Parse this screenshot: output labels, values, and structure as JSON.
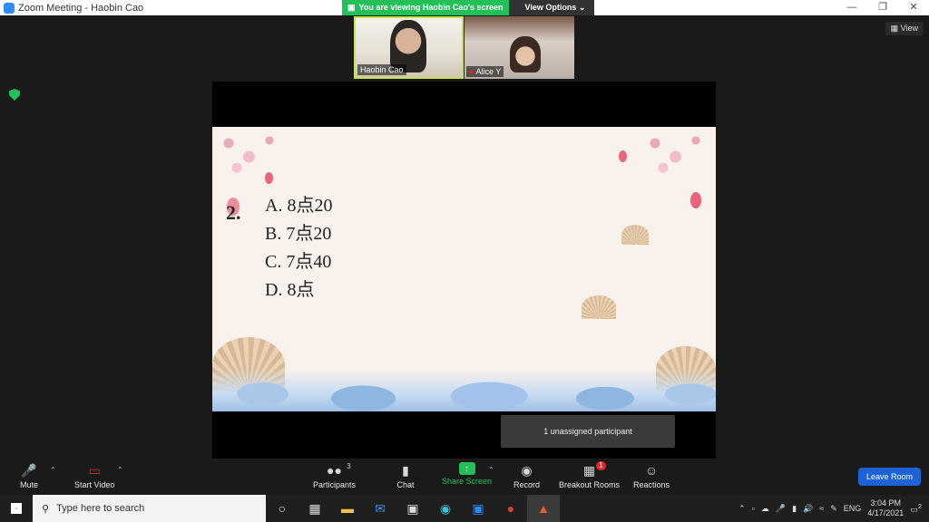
{
  "window": {
    "title": "Zoom Meeting - Haobin Cao"
  },
  "banner": {
    "viewing": "You are viewing Haobin Cao's screen",
    "view_options": "View Options"
  },
  "view_button": "View",
  "participants_video": [
    {
      "name": "Haobin Cao"
    },
    {
      "name": "Alice Y"
    }
  ],
  "slide": {
    "question_number": "2.",
    "options": [
      "A. 8点20",
      "B. 7点20",
      "C. 7点40",
      "D. 8点"
    ]
  },
  "tooltip": "1 unassigned participant",
  "toolbar": {
    "mute": "Mute",
    "start_video": "Start Video",
    "participants": "Participants",
    "participants_count": "3",
    "chat": "Chat",
    "share_screen": "Share Screen",
    "record": "Record",
    "breakout_rooms": "Breakout Rooms",
    "breakout_badge": "1",
    "reactions": "Reactions",
    "leave": "Leave Room"
  },
  "taskbar": {
    "search_placeholder": "Type here to search",
    "language": "ENG",
    "time": "3:04 PM",
    "date": "4/17/2021",
    "notification_count": "2"
  },
  "colors": {
    "share_green": "#23c05a",
    "leave_blue": "#1d62d6",
    "badge_red": "#e02828"
  }
}
